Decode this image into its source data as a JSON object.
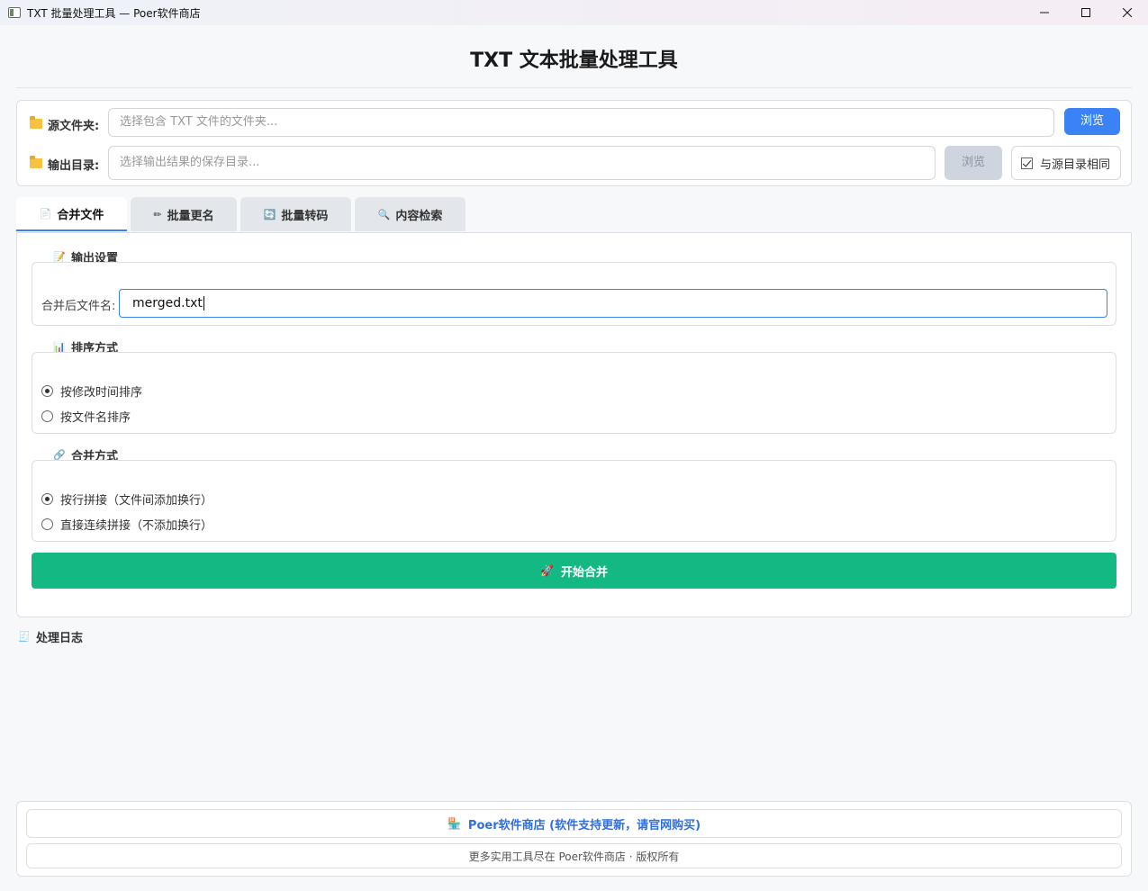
{
  "window": {
    "title": "TXT 批量处理工具 — Poer软件商店"
  },
  "heading": "TXT 文本批量处理工具",
  "paths": {
    "source_label": "源文件夹:",
    "source_placeholder": "选择包含 TXT 文件的文件夹...",
    "source_browse": "浏览",
    "output_label": "输出目录:",
    "output_placeholder": "选择输出结果的保存目录...",
    "output_browse": "浏览",
    "same_dir_label": "与源目录相同",
    "same_dir_checked": true
  },
  "tabs": [
    {
      "label": "合并文件",
      "icon": "document-icon",
      "active": true
    },
    {
      "label": "批量更名",
      "icon": "pencil-icon",
      "active": false
    },
    {
      "label": "批量转码",
      "icon": "refresh-icon",
      "active": false
    },
    {
      "label": "内容检索",
      "icon": "magnifier-icon",
      "active": false
    }
  ],
  "merge": {
    "output_group_title": "输出设置",
    "filename_label": "合并后文件名:",
    "filename_value": "merged.txt",
    "sort_group_title": "排序方式",
    "sort_options": [
      {
        "label": "按修改时间排序",
        "checked": true
      },
      {
        "label": "按文件名排序",
        "checked": false
      }
    ],
    "mode_group_title": "合并方式",
    "mode_options": [
      {
        "label": "按行拼接（文件间添加换行）",
        "checked": true
      },
      {
        "label": "直接连续拼接（不添加换行）",
        "checked": false
      }
    ],
    "start_button": "开始合并"
  },
  "log": {
    "title": "处理日志"
  },
  "footer": {
    "store_link": "Poer软件商店 (软件支持更新，请官网购买)",
    "copyright": "更多实用工具尽在 Poer软件商店 · 版权所有"
  },
  "colors": {
    "accent": "#3b82f6",
    "start_button": "#13b883",
    "link": "#2f6fe0"
  }
}
